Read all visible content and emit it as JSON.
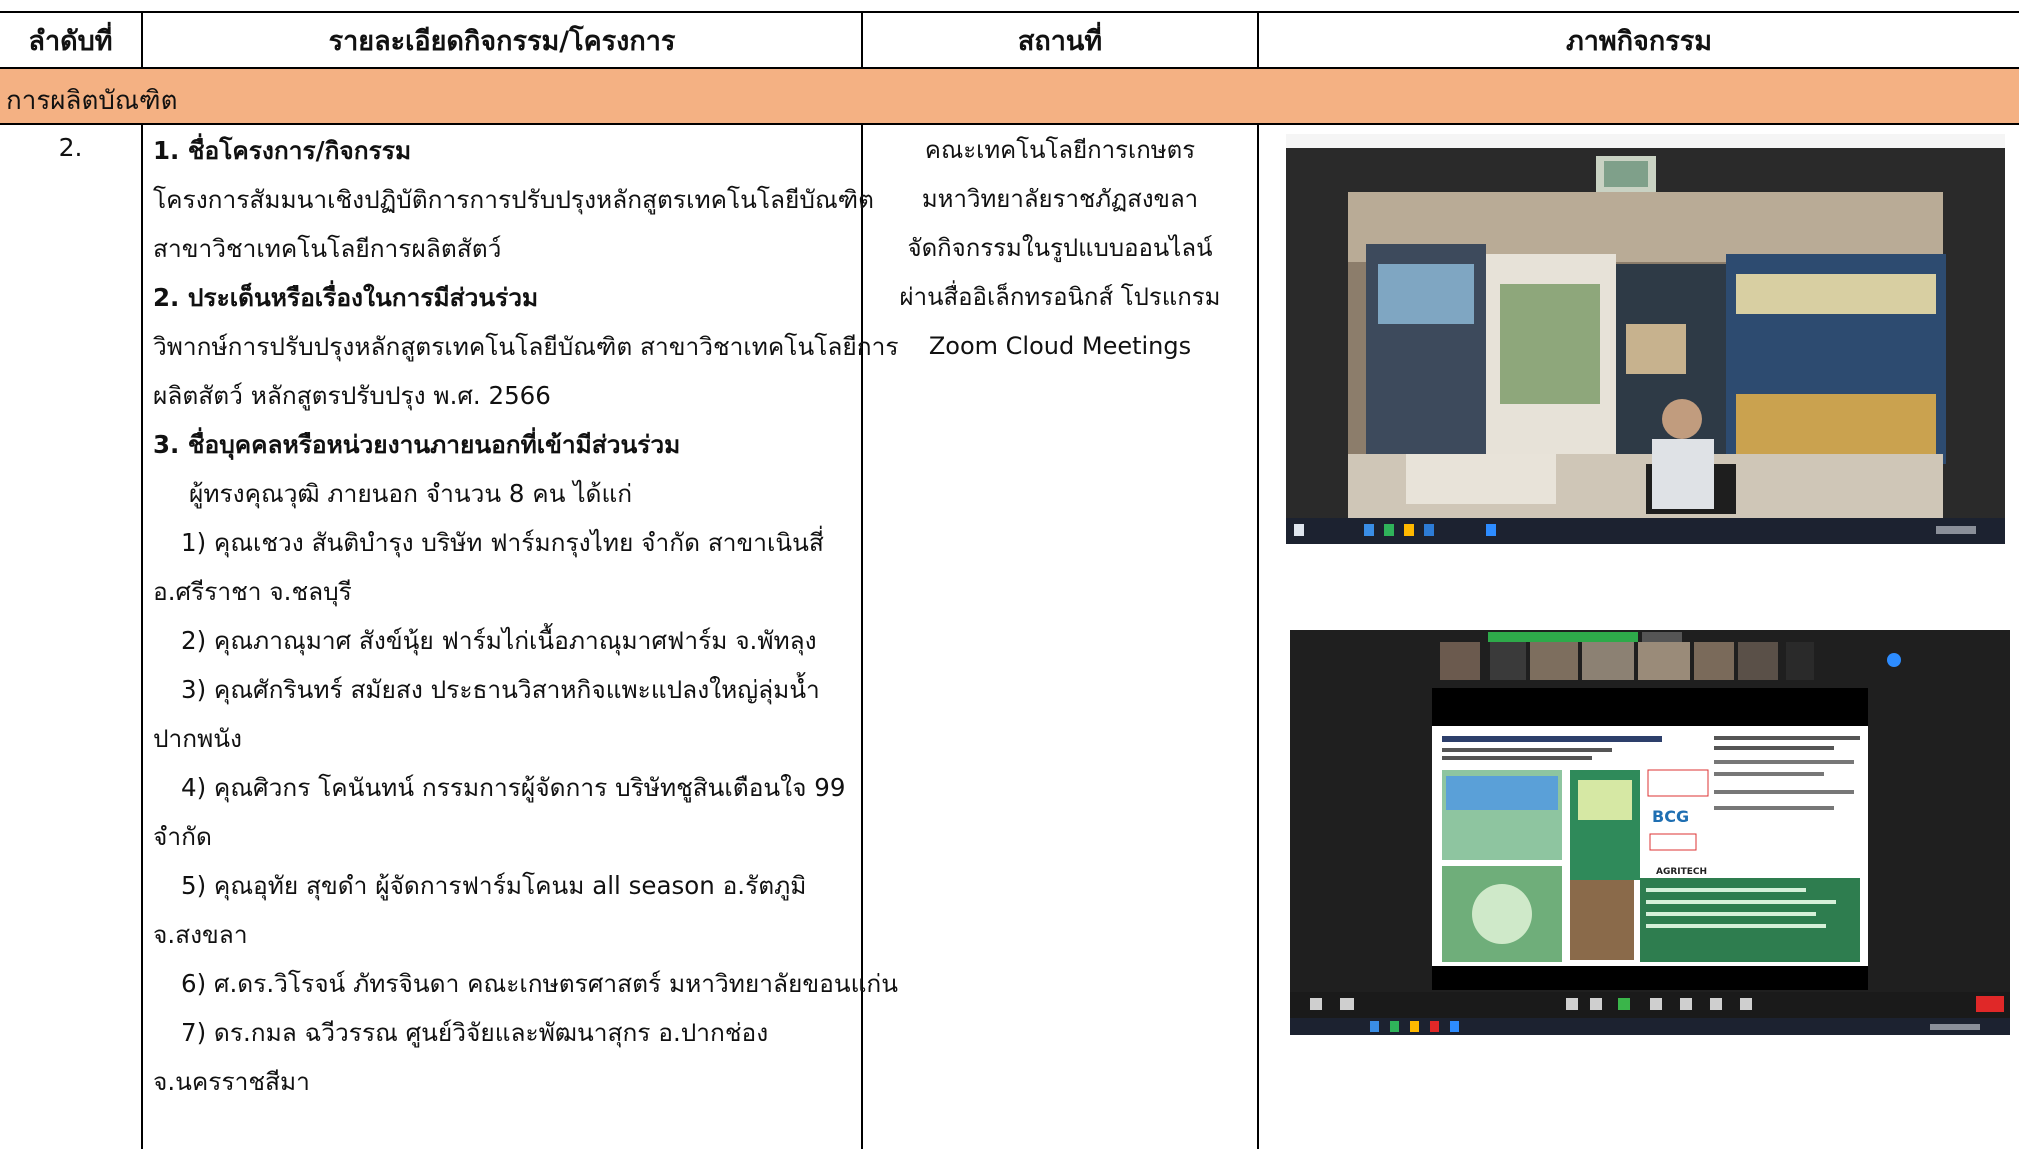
{
  "table": {
    "headers": [
      "ลำดับที่",
      "รายละเอียดกิจกรรม/โครงการ",
      "สถานที่",
      "ภาพกิจกรรม"
    ],
    "section": "การผลิตบัณฑิต",
    "row": {
      "number": "2.",
      "details": [
        "1. ชื่อโครงการ/กิจกรรม",
        "โครงการสัมมนาเชิงปฏิบัติการการปรับปรุงหลักสูตรเทคโนโลยีบัณฑิต",
        "สาขาวิชาเทคโนโลยีการผลิตสัตว์",
        "2. ประเด็นหรือเรื่องในการมีส่วนร่วม",
        "วิพากษ์การปรับปรุงหลักสูตรเทคโนโลยีบัณฑิต สาขาวิชาเทคโนโลยีการ",
        "ผลิตสัตว์ หลักสูตรปรับปรุง พ.ศ. 2566",
        "3. ชื่อบุคคลหรือหน่วยงานภายนอกที่เข้ามีส่วนร่วม",
        "ผู้ทรงคุณวุฒิ ภายนอก จำนวน 8 คน ได้แก่",
        "1)  คุณเชวง สันติบำรุง บริษัท ฟาร์มกรุงไทย จำกัด สาขาเนินสี่",
        "อ.ศรีราชา จ.ชลบุรี",
        "2) คุณภาณุมาศ สังข์นุ้ย ฟาร์มไก่เนื้อภาณุมาศฟาร์ม จ.พัทลุง",
        "3)  คุณศักรินทร์ สมัยสง ประธานวิสาหกิจแพะแปลงใหญ่ลุ่มน้ำ",
        "ปากพนัง",
        "4)  คุณศิวกร โคนันทน์ กรรมการผู้จัดการ บริษัทชูสินเตือนใจ 99",
        "จำกัด",
        "5)  คุณอุทัย สุขดำ ผู้จัดการฟาร์มโคนม all   season   อ.รัตภูมิ",
        "จ.สงขลา",
        "6) ศ.ดร.วิโรจน์ ภัทรจินดา คณะเกษตรศาสตร์ มหาวิทยาลัยขอนแก่น",
        "7)     ดร.กมล ฉวีวรรณ ศูนย์วิจัยและพัฒนาสุกร อ.ปากช่อง",
        "จ.นครราชสีมา"
      ],
      "place": [
        "คณะเทคโนโลยีการเกษตร",
        "มหาวิทยาลัยราชภัฏสงขลา",
        "จัดกิจกรรมในรูปแบบออนไลน์",
        "ผ่านสื่ออิเล็กทรอนิกส์ โปรแกรม",
        "Zoom Cloud Meetings"
      ]
    }
  },
  "photos": {
    "photo1_icon": "zoom-meeting-speaker-view",
    "photo2_icon": "zoom-meeting-slide-share",
    "zoom_slide_badges": [
      "BCG",
      "AGRITECH"
    ]
  },
  "colors": {
    "section_band": "#f4b183",
    "zoom_dark": "#1f1f1f",
    "taskbar": "#1c2230"
  }
}
